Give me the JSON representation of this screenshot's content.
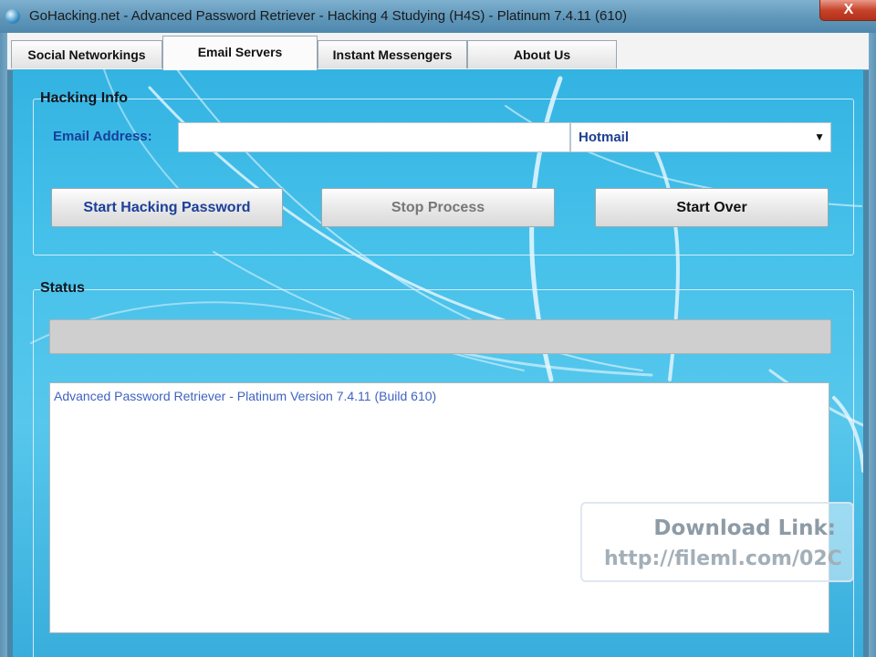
{
  "window": {
    "title": "GoHacking.net - Advanced Password Retriever - Hacking 4 Studying (H4S) - Platinum 7.4.11 (610)",
    "close_label": "X"
  },
  "tabs": [
    {
      "label": "Social Networkings",
      "active": false
    },
    {
      "label": "Email Servers",
      "active": true
    },
    {
      "label": "Instant Messengers",
      "active": false
    },
    {
      "label": "About Us",
      "active": false
    }
  ],
  "hacking_info": {
    "title": "Hacking Info",
    "email_label": "Email Address:",
    "email_value": "",
    "provider_selected": "Hotmail",
    "dropdown_arrow": "▼",
    "buttons": {
      "start": "Start Hacking Password",
      "stop": "Stop Process",
      "start_over": "Start Over"
    }
  },
  "status": {
    "title": "Status",
    "progress_fraction": 0,
    "log_lines": [
      "Advanced Password Retriever - Platinum Version 7.4.11 (Build 610)"
    ]
  },
  "watermark": {
    "line1": "Download Link:",
    "line2": "http://fileml.com/02C"
  },
  "colors": {
    "background_blue": "#46c1ea",
    "label_blue": "#163f9a",
    "log_text": "#3f63c0"
  }
}
